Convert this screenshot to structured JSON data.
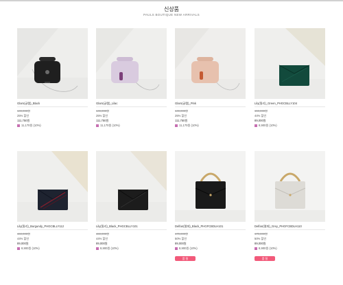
{
  "header": {
    "title": "신상품",
    "subtitle": "PAULS BOUTIQUE NEW ARRIVALS"
  },
  "products": [
    {
      "name": "Glam(글램)_Black",
      "original": "149,000원",
      "discount": "25% 할인",
      "price": "111,750원",
      "points": "11,170원 (10%)",
      "badge": ""
    },
    {
      "name": "Glam(글램)_Lilac",
      "original": "149,000원",
      "discount": "25% 할인",
      "price": "111,750원",
      "points": "11,170원 (10%)",
      "badge": ""
    },
    {
      "name": "Glam(글램)_Pink",
      "original": "149,000원",
      "discount": "25% 할인",
      "price": "111,750원",
      "points": "11,170원 (10%)",
      "badge": ""
    },
    {
      "name": "Lily(릴리)_Green_PHGCBLLY104",
      "original": "159,000원",
      "discount": "44% 할인",
      "price": "89,000원",
      "points": "8,900원 (10%)",
      "badge": ""
    },
    {
      "name": "Lily(릴리)_Burgundy_PHGCBLLY112",
      "original": "159,000원",
      "discount": "44% 할인",
      "price": "89,000원",
      "points": "8,900원 (10%)",
      "badge": ""
    },
    {
      "name": "Lily(릴리)_Black_PHGCBLLY101",
      "original": "159,000원",
      "discount": "44% 할인",
      "price": "89,000원",
      "points": "8,900원 (10%)",
      "badge": ""
    },
    {
      "name": "Delfan(델파)_Black_PHGFCBDLH101",
      "original": "179,000원",
      "discount": "50% 할인",
      "price": "89,000원",
      "points": "8,900원 (10%)",
      "badge": "품 절"
    },
    {
      "name": "Delfan(델파)_Grey_PHGFCBDLH110",
      "original": "179,000원",
      "discount": "50% 할인",
      "price": "89,000원",
      "points": "8,900원 (10%)",
      "badge": "품 절"
    }
  ],
  "colors": {
    "badge": "#f25a7a",
    "point_icon": "#c66fb1"
  }
}
